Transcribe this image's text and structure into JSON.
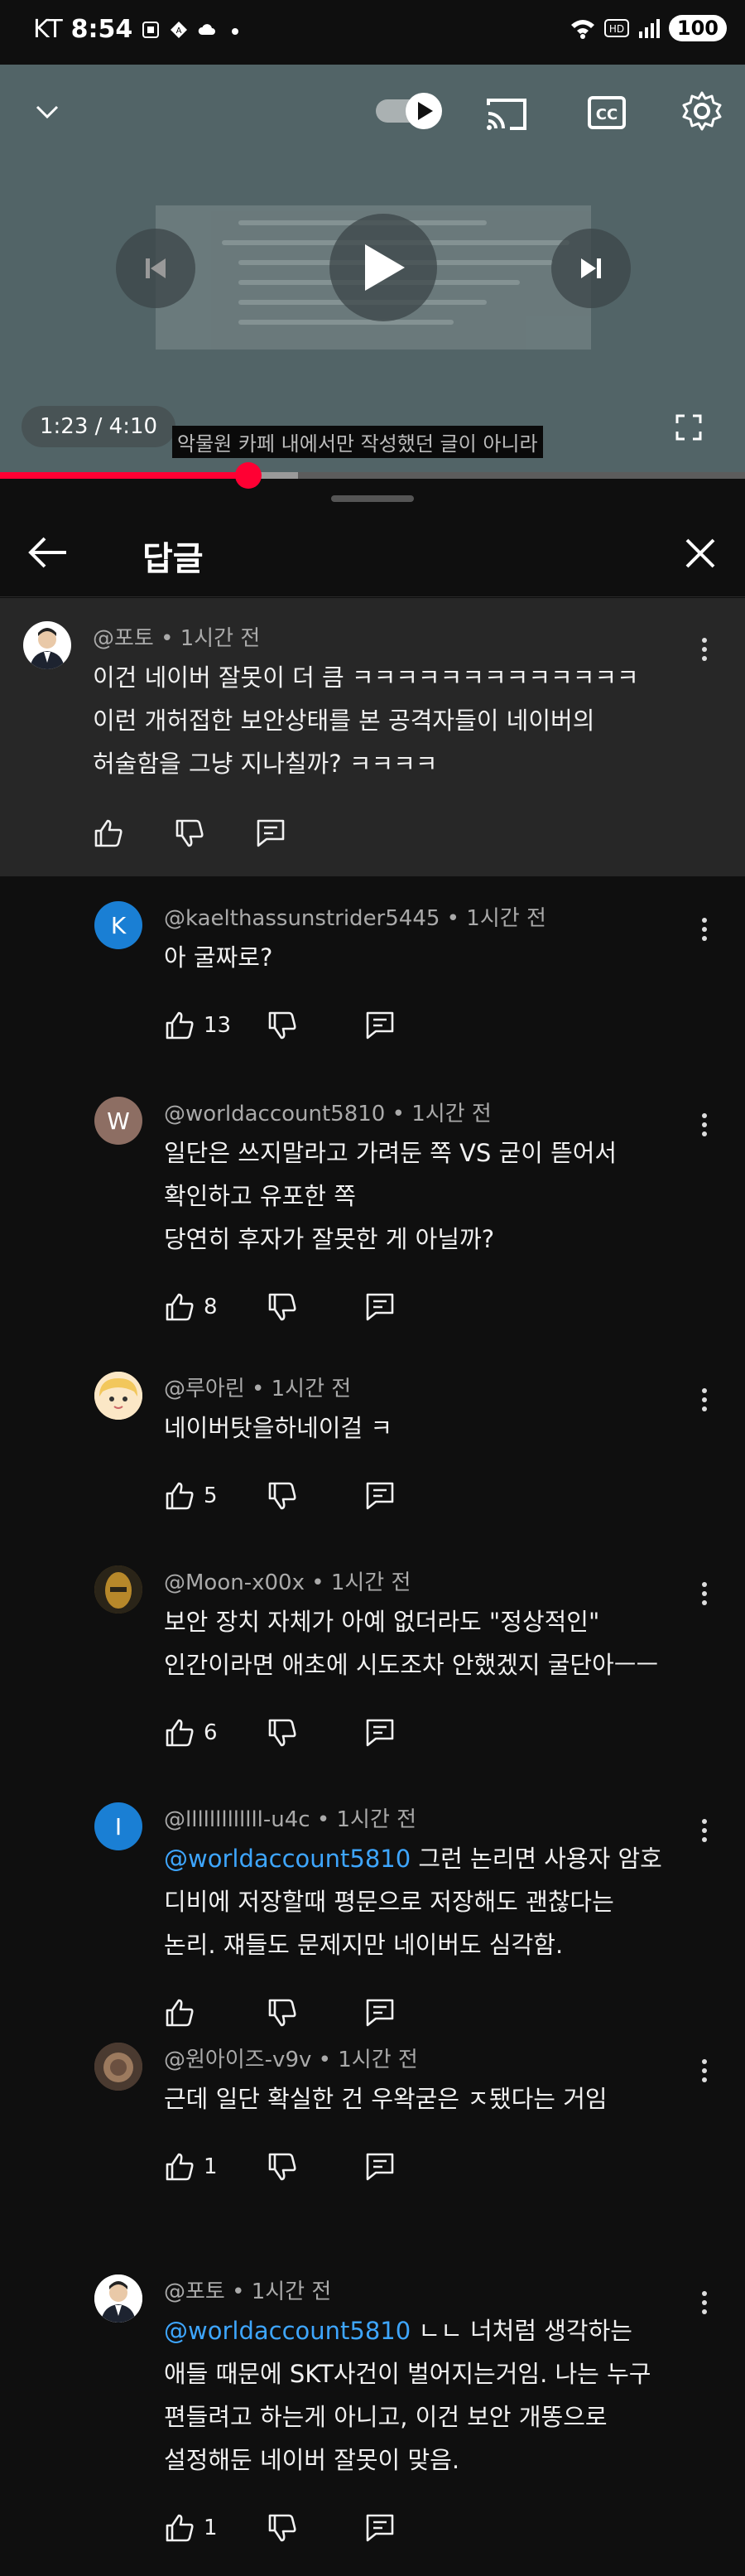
{
  "status_bar": {
    "carrier": "KT",
    "time": "8:54",
    "battery": "100"
  },
  "video": {
    "time_display": "1:23 / 4:10",
    "caption": "악물원 카페 내에서만 작성했던 글이 아니라",
    "progress_fraction": 0.333,
    "buffer_fraction": 0.4
  },
  "panel": {
    "title": "답글"
  },
  "parent_comment": {
    "author": "@포토",
    "time": "1시간 전",
    "lines": [
      "이건 네이버 잘못이 더 큼 ㅋㅋㅋㅋㅋㅋㅋㅋㅋㅋㅋㅋㅋ",
      "이런 개허접한 보안상태를 본 공격자들이 네이버의",
      "허술함을 그냥 지나칠까? ㅋㅋㅋㅋ"
    ]
  },
  "replies": [
    {
      "author": "@kaelthassunstrider5445",
      "time": "1시간 전",
      "avatar_letter": "K",
      "avatar_color": "#1a7fd4",
      "mention": "",
      "lines": [
        "아 굴짜로?"
      ],
      "likes": "13"
    },
    {
      "author": "@worldaccount5810",
      "time": "1시간 전",
      "avatar_letter": "W",
      "avatar_color": "#8d6e63",
      "mention": "",
      "lines": [
        "일단은 쓰지말라고 가려둔 쪽 VS 굳이 뜯어서",
        "확인하고 유포한 쪽",
        "당연히 후자가 잘못한 게 아닐까?"
      ],
      "likes": "8"
    },
    {
      "author": "@루아린",
      "time": "1시간 전",
      "avatar_letter": "",
      "avatar_color": "#f3d7a6",
      "mention": "",
      "lines": [
        "네이버탓을하네이걸 ㅋ"
      ],
      "likes": "5"
    },
    {
      "author": "@Moon-x00x",
      "time": "1시간 전",
      "avatar_letter": "",
      "avatar_color": "#7a5a1c",
      "mention": "",
      "lines": [
        "보안 장치 자체가 아예 없더라도 \"정상적인\"",
        "인간이라면 애초에 시도조차 안했겠지 굴단아ㅡㅡ"
      ],
      "likes": "6"
    },
    {
      "author": "@lllllllllllll-u4c",
      "time": "1시간 전",
      "avatar_letter": "I",
      "avatar_color": "#1a7fd4",
      "mention": "@worldaccount5810",
      "lines": [
        " 그런 논리면 사용자 암호",
        "디비에 저장할때 평문으로 저장해도 괜찮다는",
        "논리. 쟤들도 문제지만 네이버도 심각함."
      ],
      "likes": ""
    },
    {
      "author": "@원아이즈-v9v",
      "time": "1시간 전",
      "avatar_letter": "",
      "avatar_color": "#6b5040",
      "mention": "",
      "lines": [
        "근데 일단 확실한 건 우왁굳은 ㅈ됐다는 거임"
      ],
      "likes": "1"
    },
    {
      "author": "@포토",
      "time": "1시간 전",
      "avatar_letter": "",
      "avatar_color": "#ffffff",
      "mention": "@worldaccount5810",
      "lines": [
        " ㄴㄴ 너처럼 생각하는",
        "애들 때문에 SKT사건이 벌어지는거임. 나는 누구",
        "편들려고 하는게 아니고, 이건 보안 개똥으로",
        "설정해둔 네이버 잘못이 맞음."
      ],
      "likes": "1"
    }
  ]
}
